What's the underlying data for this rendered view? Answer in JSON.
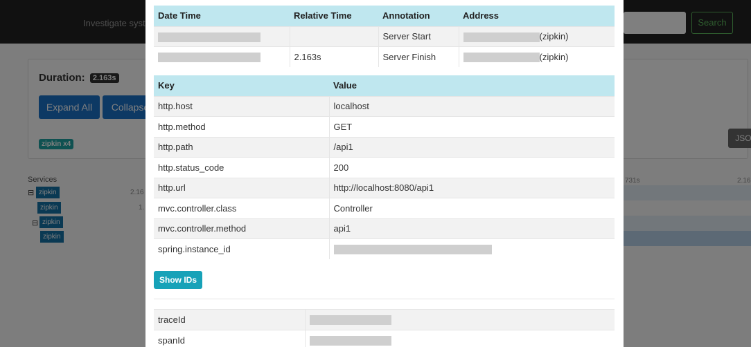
{
  "background": {
    "navbar": {
      "search_hint": "Investigate syste",
      "search_button": "Search"
    },
    "trace": {
      "duration_label": "Duration:",
      "duration_value": "2.163s",
      "expand_all": "Expand All",
      "collapse_all": "Collapse",
      "service_badge": "zipkin x4",
      "json_button": "JSON"
    },
    "timeline": {
      "services_label": "Services",
      "services": [
        "zipkin",
        "zipkin",
        "zipkin",
        "zipkin"
      ],
      "values": [
        "2.16",
        "1.",
        "",
        ""
      ],
      "tick_left": "731s",
      "tick_right": "2.16"
    }
  },
  "annotations": {
    "headers": [
      "Date Time",
      "Relative Time",
      "Annotation",
      "Address"
    ],
    "rows": [
      {
        "relative": "",
        "annotation": "Server Start",
        "address_suffix": "(zipkin)"
      },
      {
        "relative": "2.163s",
        "annotation": "Server Finish",
        "address_suffix": "(zipkin)"
      }
    ]
  },
  "tags": {
    "headers": [
      "Key",
      "Value"
    ],
    "rows": [
      {
        "key": "http.host",
        "value": "localhost"
      },
      {
        "key": "http.method",
        "value": "GET"
      },
      {
        "key": "http.path",
        "value": "/api1"
      },
      {
        "key": "http.status_code",
        "value": "200"
      },
      {
        "key": "http.url",
        "value": "http://localhost:8080/api1"
      },
      {
        "key": "mvc.controller.class",
        "value": "Controller"
      },
      {
        "key": "mvc.controller.method",
        "value": "api1"
      },
      {
        "key": "spring.instance_id",
        "value": ""
      }
    ]
  },
  "show_ids_button": "Show IDs",
  "ids": {
    "rows": [
      {
        "key": "traceId"
      },
      {
        "key": "spanId"
      }
    ]
  }
}
